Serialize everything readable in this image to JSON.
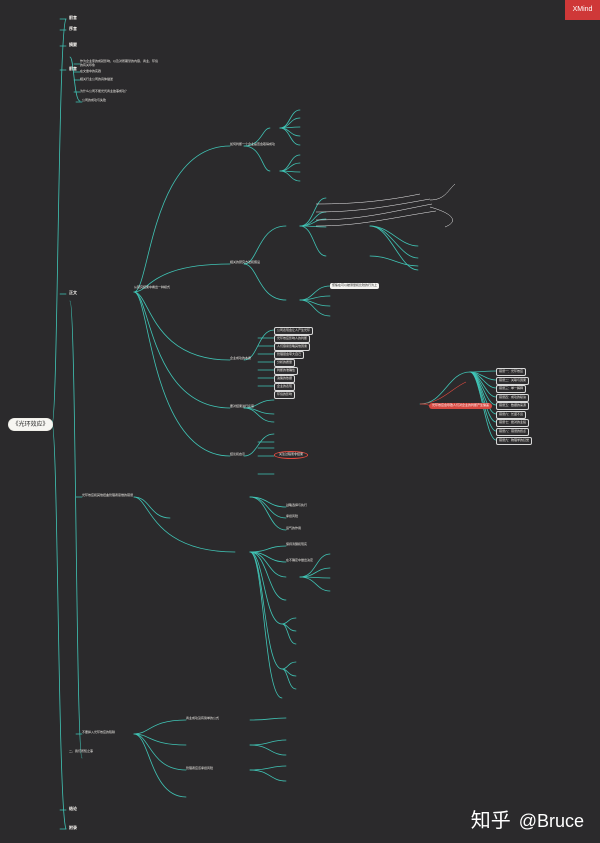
{
  "app_badge": "XMind",
  "watermark": {
    "brand": "知乎",
    "handle": "@Bruce"
  },
  "root": "《光环效应》",
  "main": {
    "a": "前言",
    "b": "序言",
    "c": "摘要",
    "d": "前言",
    "e": "正文",
    "f": "结论",
    "g": "附录"
  },
  "intro": {
    "notes": "作为企业家的成就影响，以及对所期望的内容、商业、环境的有关印象",
    "cache": "在文章中的实践",
    "loop": "相关行业公司的具体描述",
    "check": "为什么公司不能光凭商业故事成功？"
  },
  "chapters": {
    "one": "公司的成功与失败",
    "two": "光环效应和其他扭曲管理者思维的错误",
    "three": "不要掉入光环效应的陷阱",
    "four": "结论和启示"
  },
  "mid": {
    "deep": "从研究结果中看出一种模式",
    "hints": "如何判断一个企业是否会取得成功",
    "fault": "相关的研究方法和假设",
    "fix": "企业成功的本质",
    "core": "要对结果进行反思"
  },
  "right": {
    "list": [
      "公司表现会让人产生光环",
      "光环效应影响人的判断",
      "人们容易忽略其他因素",
      "管理层会夸大自己",
      "分析的质量",
      "判断的准确性",
      "决策的依据",
      "企业的表现",
      "环境的影响"
    ],
    "focus": "聚焦在可以被测量和比较的行为上",
    "flag": "光环效应会导致人们对企业的判断产生偏差",
    "circle": "关注过程而非结果"
  },
  "far_right": {
    "items": [
      "错误一：光环效应",
      "错误二：关联与因果",
      "错误三：单一解释",
      "错误四：成功的秘诀",
      "错误五：数据的来源",
      "错误六：长盛不衰",
      "错误七：绝对的业绩",
      "错误八：错误的终点",
      "错误九：物理学的幻觉"
    ]
  },
  "lower": {
    "strategy": "战略选择与执行",
    "risk": "承担风险",
    "luck": "运气的作用",
    "realism": "保持清醒和现实",
    "balance": "在不确定中做出决定"
  },
  "bottom": {
    "heading": "二、我们所知之事",
    "s1": "商业成功没有简单的公式",
    "s2": "管理者应该承担风险"
  }
}
